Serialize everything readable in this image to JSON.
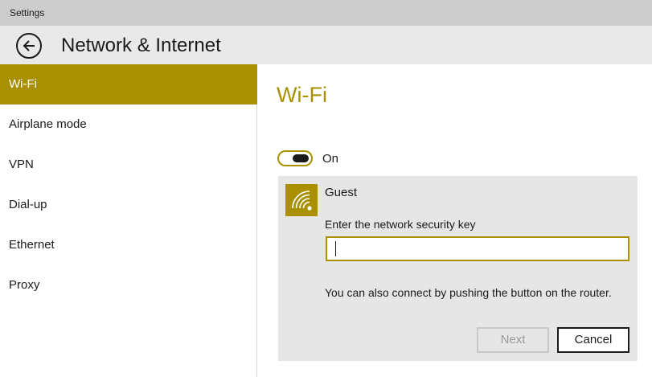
{
  "window": {
    "title": "Settings"
  },
  "header": {
    "title": "Network & Internet",
    "back_icon": "back-arrow-icon"
  },
  "sidebar": {
    "items": [
      {
        "label": "Wi-Fi",
        "active": true
      },
      {
        "label": "Airplane mode",
        "active": false
      },
      {
        "label": "VPN",
        "active": false
      },
      {
        "label": "Dial-up",
        "active": false
      },
      {
        "label": "Ethernet",
        "active": false
      },
      {
        "label": "Proxy",
        "active": false
      }
    ]
  },
  "main": {
    "heading": "Wi-Fi",
    "wifi_toggle": {
      "label": "On",
      "state": true
    },
    "network": {
      "name": "Guest",
      "icon": "wifi-secured-icon",
      "key_label": "Enter the network security key",
      "key_value": "",
      "router_hint": "You can also connect by pushing the button on the router.",
      "next_label": "Next",
      "cancel_label": "Cancel"
    }
  },
  "colors": {
    "accent": "#a99000",
    "titlebar": "#cccccc",
    "header": "#e9e9e9",
    "panel": "#e6e6e6"
  }
}
